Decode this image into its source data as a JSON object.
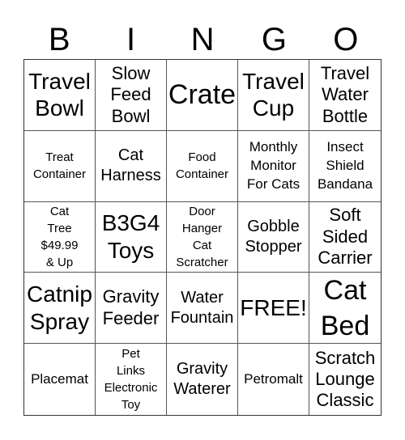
{
  "header": {
    "letters": [
      "B",
      "I",
      "N",
      "G",
      "O"
    ]
  },
  "cells": [
    {
      "text": "Travel\nBowl",
      "size": "s-l"
    },
    {
      "text": "Slow\nFeed\nBowl",
      "size": "s-ml"
    },
    {
      "text": "Crate",
      "size": "s-xl"
    },
    {
      "text": "Travel\nCup",
      "size": "s-l"
    },
    {
      "text": "Travel\nWater\nBottle",
      "size": "s-ml"
    },
    {
      "text": "Treat\nContainer",
      "size": "s-xs"
    },
    {
      "text": "Cat\nHarness",
      "size": "s-m"
    },
    {
      "text": "Food\nContainer",
      "size": "s-xs"
    },
    {
      "text": "Monthly\nMonitor\nFor Cats",
      "size": "s-s"
    },
    {
      "text": "Insect\nShield\nBandana",
      "size": "s-s"
    },
    {
      "text": "Cat\nTree\n$49.99\n& Up",
      "size": "s-xs"
    },
    {
      "text": "B3G4\nToys",
      "size": "s-l"
    },
    {
      "text": "Door\nHanger\nCat\nScratcher",
      "size": "s-xs"
    },
    {
      "text": "Gobble\nStopper",
      "size": "s-m"
    },
    {
      "text": "Soft\nSided\nCarrier",
      "size": "s-ml"
    },
    {
      "text": "Catnip\nSpray",
      "size": "s-l"
    },
    {
      "text": "Gravity\nFeeder",
      "size": "s-ml"
    },
    {
      "text": "Water\nFountain",
      "size": "s-m"
    },
    {
      "text": "FREE!",
      "size": "s-l"
    },
    {
      "text": "Cat\nBed",
      "size": "s-xl"
    },
    {
      "text": "Placemat",
      "size": "s-s"
    },
    {
      "text": "Pet\nLinks\nElectronic\nToy",
      "size": "s-xs"
    },
    {
      "text": "Gravity\nWaterer",
      "size": "s-m"
    },
    {
      "text": "Petromalt",
      "size": "s-s"
    },
    {
      "text": "Scratch\nLounge\nClassic",
      "size": "s-ml"
    }
  ]
}
